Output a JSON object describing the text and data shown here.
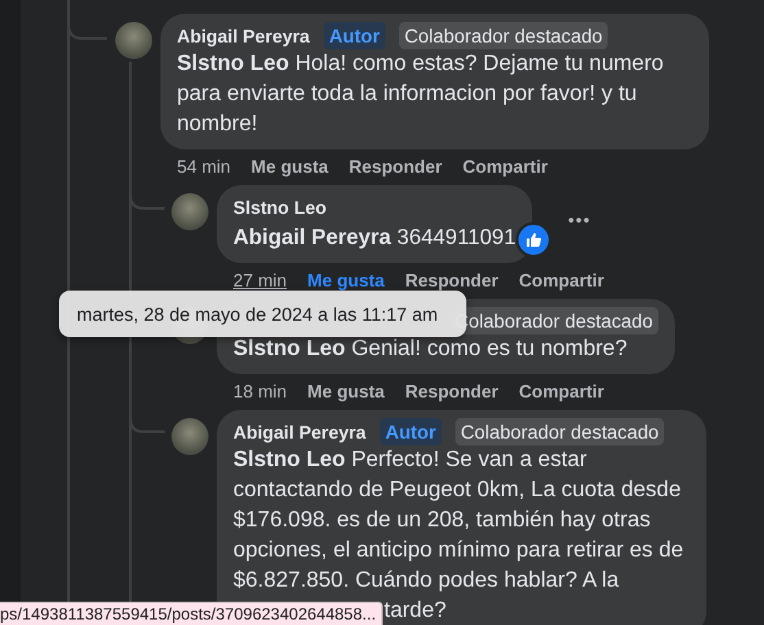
{
  "comments": [
    {
      "author": "Abigail Pereyra",
      "badges": [
        {
          "label": "Autor",
          "kind": "author"
        },
        {
          "label": "Colaborador destacado",
          "kind": "contributor"
        }
      ],
      "mention": "Slstno Leo",
      "text": "Hola! como estas? Dejame tu numero para enviarte toda la informacion por favor! y tu nombre!",
      "time": "54 min",
      "time_hovered": false,
      "actions": [
        {
          "label": "Me gusta",
          "selected": false
        },
        {
          "label": "Responder"
        },
        {
          "label": "Compartir"
        }
      ],
      "children": [
        {
          "author": "Slstno Leo",
          "mention": "Abigail Pereyra",
          "text": "3644911091",
          "liked": true,
          "menu": "•••",
          "time": "27 min",
          "time_hovered": true,
          "actions": [
            {
              "label": "Me gusta",
              "selected": true
            },
            {
              "label": "Responder"
            },
            {
              "label": "Compartir"
            }
          ]
        },
        {
          "badges": [
            {
              "label": "Colaborador destacado",
              "kind": "contributor"
            }
          ],
          "mention": "Slstno Leo",
          "text": "Genial! como es tu nombre?",
          "time": "18 min",
          "time_hovered": false,
          "actions": [
            {
              "label": "Me gusta",
              "selected": false
            },
            {
              "label": "Responder"
            },
            {
              "label": "Compartir"
            }
          ]
        },
        {
          "author": "Abigail Pereyra",
          "badges": [
            {
              "label": "Autor",
              "kind": "author"
            },
            {
              "label": "Colaborador destacado",
              "kind": "contributor"
            }
          ],
          "mention": "Slstno Leo",
          "text": "Perfecto! Se van a estar contactando de Peugeot 0km, La cuota desde $176.098. es de un 208, también hay otras opciones, el anticipo mínimo para retirar es de $6.827.850. Cuándo podes hablar? A la",
          "text_end": "tarde?"
        }
      ]
    }
  ],
  "tooltip": "martes, 28 de mayo de 2024 a las 11:17 am",
  "status_bar": {
    "url": "ps/1493811387559415/posts/3709623402644858..."
  }
}
